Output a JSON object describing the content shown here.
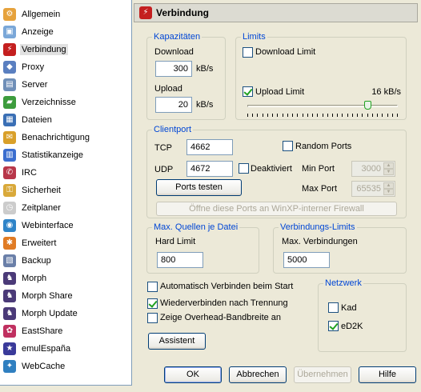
{
  "sidebar": {
    "items": [
      {
        "label": "Allgemein",
        "icon": "gear-icon",
        "color": "#e6a23c"
      },
      {
        "label": "Anzeige",
        "icon": "display-icon",
        "color": "#7aa7d8"
      },
      {
        "label": "Verbindung",
        "icon": "connection-icon",
        "color": "#c41f1f"
      },
      {
        "label": "Proxy",
        "icon": "proxy-icon",
        "color": "#5a7fc0"
      },
      {
        "label": "Server",
        "icon": "server-icon",
        "color": "#6f8fb8"
      },
      {
        "label": "Verzeichnisse",
        "icon": "folder-icon",
        "color": "#3d9c3d"
      },
      {
        "label": "Dateien",
        "icon": "files-icon",
        "color": "#3a6fb5"
      },
      {
        "label": "Benachrichtigung",
        "icon": "notification-icon",
        "color": "#d9a02a"
      },
      {
        "label": "Statistikanzeige",
        "icon": "statistics-icon",
        "color": "#3b6ecf"
      },
      {
        "label": "IRC",
        "icon": "irc-icon",
        "color": "#b8374a"
      },
      {
        "label": "Sicherheit",
        "icon": "shield-icon",
        "color": "#d9a93a"
      },
      {
        "label": "Zeitplaner",
        "icon": "scheduler-icon",
        "color": "#cccccc"
      },
      {
        "label": "Webinterface",
        "icon": "web-icon",
        "color": "#2f84c8"
      },
      {
        "label": "Erweitert",
        "icon": "advanced-icon",
        "color": "#e07b24"
      },
      {
        "label": "Backup",
        "icon": "backup-icon",
        "color": "#6a7fa8"
      },
      {
        "label": "Morph",
        "icon": "morph-icon",
        "color": "#4b3a78"
      },
      {
        "label": "Morph Share",
        "icon": "morph-share-icon",
        "color": "#4b3a78"
      },
      {
        "label": "Morph Update",
        "icon": "morph-update-icon",
        "color": "#4b3a78"
      },
      {
        "label": "EastShare",
        "icon": "eastshare-icon",
        "color": "#c03060"
      },
      {
        "label": "emulEspaña",
        "icon": "emulespana-icon",
        "color": "#3a3a9a"
      },
      {
        "label": "WebCache",
        "icon": "webcache-icon",
        "color": "#2f7fc0"
      }
    ],
    "selected": "Verbindung"
  },
  "header": {
    "title": "Verbindung",
    "icon": "connection-icon"
  },
  "kapazitaeten": {
    "legend": "Kapazitäten",
    "download_label": "Download",
    "download_value": "300",
    "download_unit": "kB/s",
    "upload_label": "Upload",
    "upload_value": "20",
    "upload_unit": "kB/s"
  },
  "limits": {
    "legend": "Limits",
    "download_limit_label": "Download Limit",
    "download_limit_checked": false,
    "upload_limit_label": "Upload Limit",
    "upload_limit_checked": true,
    "upload_limit_value": "16 kB/s",
    "slider_fraction": 0.8
  },
  "clientport": {
    "legend": "Clientport",
    "tcp_label": "TCP",
    "tcp_value": "4662",
    "udp_label": "UDP",
    "udp_value": "4672",
    "deaktiviert_label": "Deaktiviert",
    "random_ports_label": "Random Ports",
    "min_port_label": "Min Port",
    "min_port_value": "3000",
    "max_port_label": "Max Port",
    "max_port_value": "65535",
    "test_button": "Ports testen",
    "firewall_button": "Öffne diese Ports an WinXP-interner Firewall"
  },
  "max_quellen": {
    "legend": "Max. Quellen je Datei",
    "hard_limit_label": "Hard Limit",
    "hard_limit_value": "800"
  },
  "verbindungs_limits": {
    "legend": "Verbindungs-Limits",
    "max_label": "Max. Verbindungen",
    "max_value": "5000"
  },
  "options": {
    "auto_connect_label": "Automatisch Verbinden beim Start",
    "auto_connect_checked": false,
    "reconnect_label": "Wiederverbinden nach Trennung",
    "reconnect_checked": true,
    "overhead_label": "Zeige Overhead-Bandbreite an",
    "overhead_checked": false,
    "assistant_button": "Assistent"
  },
  "netzwerk": {
    "legend": "Netzwerk",
    "kad_label": "Kad",
    "kad_checked": false,
    "ed2k_label": "eD2K",
    "ed2k_checked": true
  },
  "footer": {
    "ok": "OK",
    "cancel": "Abbrechen",
    "apply": "Übernehmen",
    "help": "Hilfe"
  }
}
